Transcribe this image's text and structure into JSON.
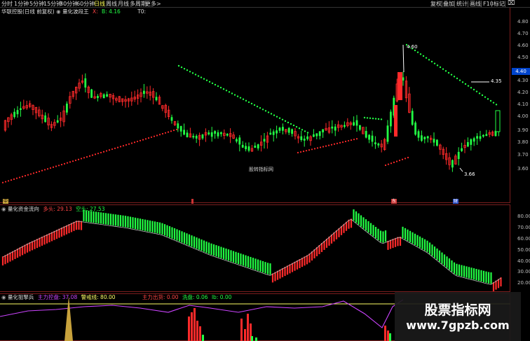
{
  "toolbar": {
    "timeframes": [
      "分时",
      "1分钟",
      "5分钟",
      "15分钟",
      "30分钟",
      "60分钟",
      "日线",
      "周线",
      "月线",
      "多周期",
      "更多>"
    ],
    "active_index": 6,
    "right_buttons": [
      "复权",
      "叠加",
      "统计",
      "画线",
      "F10",
      "标记"
    ],
    "close_glyph": "⌧",
    "close_glyph_color": "#ff4444"
  },
  "main_panel": {
    "title": "华联控股(日线 前复权)",
    "indicator_name": "量化波段王",
    "param_x": "X:",
    "param_b": "B: 4.16",
    "param_t0": "T0:",
    "price_ticks": [
      "4.80",
      "4.70",
      "4.60",
      "4.50",
      "4.40",
      "4.30",
      "4.20",
      "4.10",
      "4.00",
      "3.90",
      "3.80",
      "3.70",
      "3.60"
    ],
    "current_price": "4.40",
    "current_price_bg": "#0044cc",
    "annotations": {
      "high_label": "4.60",
      "level_label": "4.35",
      "low_label": "3.66",
      "watermark": "股转指标网"
    },
    "event_markers": [
      "中",
      "东",
      "财"
    ]
  },
  "fund_panel": {
    "title": "量化资金流向",
    "bull_label": "多头: 29.13",
    "bear_label": "空头: 27.53",
    "ticks": [
      "80.00",
      "70.00",
      "60.00",
      "50.00",
      "40.00",
      "30.00",
      "20.00"
    ]
  },
  "sniper_panel": {
    "title": "量化狙擎兵",
    "main_control_label": "主力控盘:",
    "main_control_value": "37.08",
    "alert_label": "警戒线:",
    "alert_value": "80.00",
    "main_exit_label": "主力出货:",
    "main_exit_value": "0.00",
    "wash_label": "洗盘:",
    "wash_value": "0.06",
    "lb_label": "lb:",
    "lb_value": "0.00"
  },
  "watermark_box": {
    "line1": "股票指标网",
    "line2": "www.7gpzb.com"
  },
  "colors": {
    "up": "#ff2a2a",
    "down": "#22ff44",
    "axis_text": "#c0c0c0",
    "alert_line": "#ffff66",
    "sniper_line": "#cc44ff"
  }
}
